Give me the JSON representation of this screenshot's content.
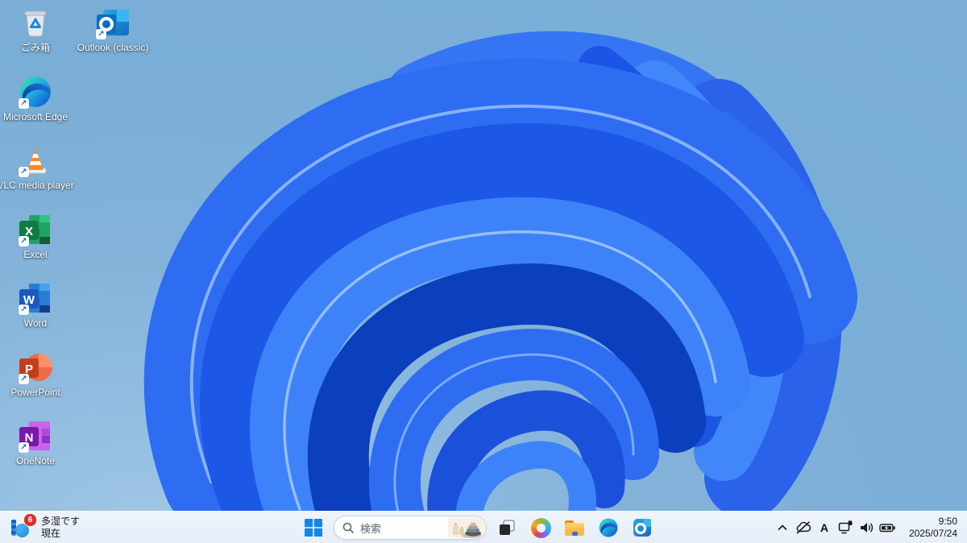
{
  "desktop": {
    "icons": [
      {
        "name": "recycle-bin",
        "label": "ごみ箱",
        "shortcut": false
      },
      {
        "name": "outlook-classic",
        "label": "Outlook (classic)",
        "shortcut": true
      },
      {
        "name": "microsoft-edge",
        "label": "Microsoft Edge",
        "shortcut": true
      },
      {
        "name": "vlc-media-player",
        "label": "VLC media player",
        "shortcut": true
      },
      {
        "name": "excel",
        "label": "Excel",
        "shortcut": true
      },
      {
        "name": "word",
        "label": "Word",
        "shortcut": true
      },
      {
        "name": "powerpoint",
        "label": "PowerPoint",
        "shortcut": true
      },
      {
        "name": "onenote",
        "label": "OneNote",
        "shortcut": true
      }
    ]
  },
  "letters": {
    "excel": "X",
    "word": "W",
    "powerpoint": "P",
    "onenote": "N",
    "shortcut_arrow": "↗"
  },
  "taskbar": {
    "widget": {
      "badge": "6",
      "line1": "多湿です",
      "line2": "現在"
    },
    "search": {
      "placeholder": "検索"
    },
    "buttons": [
      {
        "name": "start"
      },
      {
        "name": "task-view"
      },
      {
        "name": "copilot"
      },
      {
        "name": "file-explorer"
      },
      {
        "name": "edge"
      },
      {
        "name": "outlook"
      }
    ],
    "tray": {
      "ime_label": "A",
      "icons": [
        "hidden-icons-chevron",
        "onedrive-paused",
        "ime-mode",
        "network",
        "volume",
        "battery-charging"
      ],
      "time": "9:50",
      "date": "2025/07/24"
    }
  },
  "colors": {
    "desktop_background": "#79aed6",
    "taskbar_background": "#e9f0f9",
    "bloom_deep_blue": "#0c3fbe",
    "bloom_bright_blue": "#3d82f8",
    "badge_red": "#d93025",
    "start_blue": "#0f6cd6"
  }
}
